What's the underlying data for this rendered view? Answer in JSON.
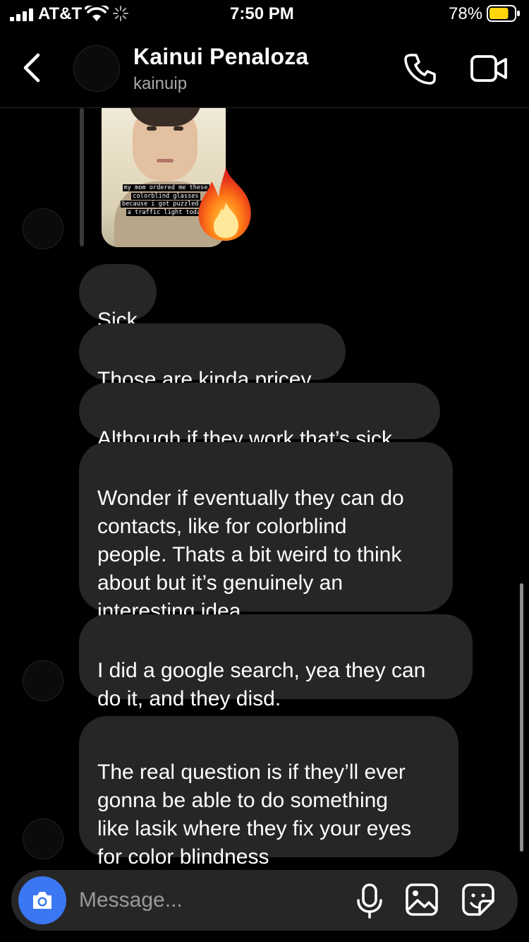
{
  "status_bar": {
    "carrier": "AT&T",
    "time": "7:50 PM",
    "battery_percent": "78%",
    "battery_level": 0.78,
    "battery_color": "#ffd60a"
  },
  "header": {
    "name": "Kainui Penaloza",
    "username": "kainuip",
    "icons": [
      "chevron-left-icon",
      "phone-icon",
      "video-camera-icon"
    ]
  },
  "story_reply": {
    "caption_lines": [
      "my mom ordered me these",
      "colorblind glasses",
      "because i got puzzled at",
      "a traffic light today"
    ],
    "reaction": "🔥"
  },
  "messages": [
    {
      "text": "Sick"
    },
    {
      "text": "Those are kinda pricey"
    },
    {
      "text": "Although if they work that’s sick"
    },
    {
      "text": "Wonder if eventually they can do\ncontacts, like for colorblind\npeople. Thats a bit weird to think\nabout but it’s genuinely an\ninteresting idea."
    },
    {
      "text": "I did a google search, yea they can\ndo it, and they disd."
    },
    {
      "text": "The real question is if they’ll ever\ngonna be able to do something\nlike lasik where they fix your eyes\nfor color blindness"
    }
  ],
  "composer": {
    "placeholder": "Message...",
    "icons": [
      "camera-icon",
      "microphone-icon",
      "gallery-icon",
      "sticker-icon"
    ],
    "camera_color": "#3b77f3"
  }
}
